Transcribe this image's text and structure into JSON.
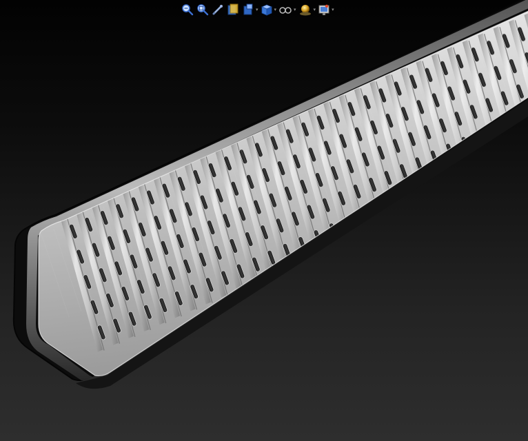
{
  "toolbar": {
    "tools": [
      {
        "name": "zoom-to-fit",
        "icon": "zoom-to-fit-icon",
        "dropdown": false
      },
      {
        "name": "zoom-to-area",
        "icon": "zoom-to-area-icon",
        "dropdown": false
      },
      {
        "name": "previous-view",
        "icon": "previous-view-icon",
        "dropdown": false
      },
      {
        "name": "section-view",
        "icon": "section-view-icon",
        "dropdown": false
      },
      {
        "name": "dynamic-annotation-views",
        "icon": "annotation-views-icon",
        "dropdown": true
      },
      {
        "name": "view-orientation",
        "icon": "view-orientation-icon",
        "dropdown": true
      },
      {
        "name": "display-style",
        "icon": "display-style-icon",
        "dropdown": true
      },
      {
        "name": "hide-show-items",
        "icon": "hide-show-items-icon",
        "dropdown": true
      },
      {
        "name": "edit-appearance",
        "icon": "appearance-icon",
        "dropdown": true
      },
      {
        "name": "view-settings",
        "icon": "view-settings-icon",
        "dropdown": true
      }
    ]
  },
  "model": {
    "description_icon": "perforated-metal-bar-3d-model",
    "colors": {
      "background_top": "#020202",
      "background_bottom": "#2e2e2e",
      "metal_light": "#e6e6e6",
      "metal_mid": "#a9a9a9",
      "frame": "#0b0b0b"
    }
  }
}
